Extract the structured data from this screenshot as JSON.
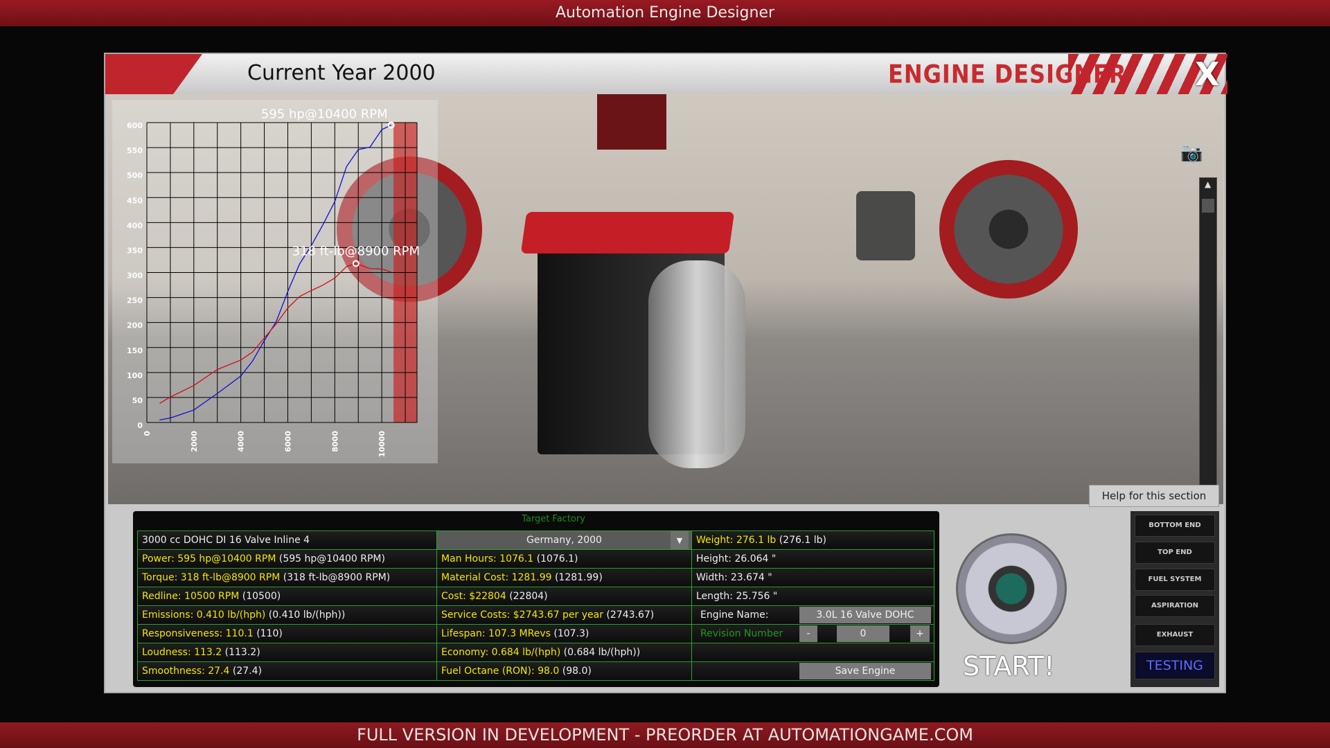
{
  "window": {
    "title": "Automation Engine Designer"
  },
  "footer": {
    "text": "FULL VERSION IN DEVELOPMENT - PREORDER AT AUTOMATIONGAME.COM"
  },
  "header": {
    "current_year": "Current Year 2000",
    "brand": "ENGINE DESIGNER",
    "close_label": "X"
  },
  "viewport": {
    "help_label": "Help for this section",
    "icons": [
      "camera-icon",
      "scroll-up-icon",
      "scroll-down-icon"
    ]
  },
  "chart_data": {
    "type": "line",
    "xlim": [
      0,
      11500
    ],
    "ylim": [
      0,
      600
    ],
    "x_ticks": [
      "0",
      "2000",
      "4000",
      "6000",
      "8000",
      "10000"
    ],
    "y_ticks": [
      "0",
      "50",
      "100",
      "150",
      "200",
      "250",
      "300",
      "350",
      "400",
      "450",
      "500",
      "550",
      "600"
    ],
    "grid": true,
    "redline_rpm": 10500,
    "series": [
      {
        "color": "#1010d0",
        "peak_label": "595 hp@10400 RPM",
        "peak": [
          10400,
          595
        ],
        "points": [
          [
            540,
            5
          ],
          [
            1000,
            9
          ],
          [
            2000,
            25
          ],
          [
            3000,
            58
          ],
          [
            4000,
            93
          ],
          [
            4500,
            123
          ],
          [
            5000,
            164
          ],
          [
            5500,
            201
          ],
          [
            6000,
            262
          ],
          [
            6500,
            317
          ],
          [
            7000,
            354
          ],
          [
            7500,
            396
          ],
          [
            8000,
            442
          ],
          [
            8500,
            512
          ],
          [
            9000,
            546
          ],
          [
            9500,
            551
          ],
          [
            10000,
            586
          ],
          [
            10400,
            595
          ]
        ]
      },
      {
        "color": "#d01010",
        "peak_label": "318 ft-lb@8900 RPM",
        "peak": [
          8900,
          318
        ],
        "points": [
          [
            540,
            38
          ],
          [
            1000,
            51
          ],
          [
            2000,
            74
          ],
          [
            3000,
            106
          ],
          [
            4000,
            125
          ],
          [
            4500,
            141
          ],
          [
            5000,
            169
          ],
          [
            5500,
            197
          ],
          [
            6000,
            229
          ],
          [
            6500,
            252
          ],
          [
            7000,
            264
          ],
          [
            7500,
            275
          ],
          [
            8000,
            289
          ],
          [
            8500,
            312
          ],
          [
            8900,
            318
          ],
          [
            9500,
            308
          ],
          [
            10000,
            307
          ],
          [
            10400,
            301
          ]
        ]
      }
    ]
  },
  "stats": {
    "target_factory_label": "Target Factory",
    "engine_desc": "3000 cc DOHC DI 16 Valve Inline 4",
    "factory_value": "Germany, 2000",
    "col1": [
      {
        "k": "Power: 595 hp@10400 RPM",
        "v": "(595 hp@10400 RPM)"
      },
      {
        "k": "Torque: 318 ft-lb@8900 RPM",
        "v": "(318 ft-lb@8900 RPM)"
      },
      {
        "k": "Redline: 10500 RPM",
        "v": "(10500)"
      },
      {
        "k": "Emissions: 0.410 lb/(hph)",
        "v": "(0.410 lb/(hph))"
      },
      {
        "k": "Responsiveness: 110.1",
        "v": "(110)"
      },
      {
        "k": "Loudness: 113.2",
        "v": "(113.2)"
      },
      {
        "k": "Smoothness: 27.4",
        "v": "(27.4)"
      }
    ],
    "col2": [
      {
        "k": "Man Hours: 1076.1",
        "v": "(1076.1)"
      },
      {
        "k": "Material Cost: 1281.99",
        "v": "(1281.99)"
      },
      {
        "k": "Cost: $22804",
        "v": "(22804)"
      },
      {
        "k": "Service Costs: $2743.67 per year",
        "v": "(2743.67)"
      },
      {
        "k": "Lifespan: 107.3 MRevs",
        "v": "(107.3)"
      },
      {
        "k": "Economy: 0.684 lb/(hph)",
        "v": "(0.684 lb/(hph))"
      },
      {
        "k": "Fuel Octane (RON): 98.0",
        "v": "(98.0)"
      }
    ],
    "weight": {
      "k": "Weight: 276.1 lb",
      "v": "(276.1 lb)"
    },
    "height": "Height: 26.064 \"",
    "width": "Width: 23.674 \"",
    "length": "Length: 25.756 \"",
    "engine_name_label": "Engine Name:",
    "engine_name_value": "3.0L 16 Valve DOHC",
    "revision_label": "Revision Number",
    "revision_minus": "-",
    "revision_value": "0",
    "revision_plus": "+",
    "save_label": "Save Engine"
  },
  "start_label": "START!",
  "sections": [
    "BOTTOM END",
    "TOP END",
    "FUEL SYSTEM",
    "ASPIRATION",
    "EXHAUST"
  ],
  "active_section": "TESTING"
}
